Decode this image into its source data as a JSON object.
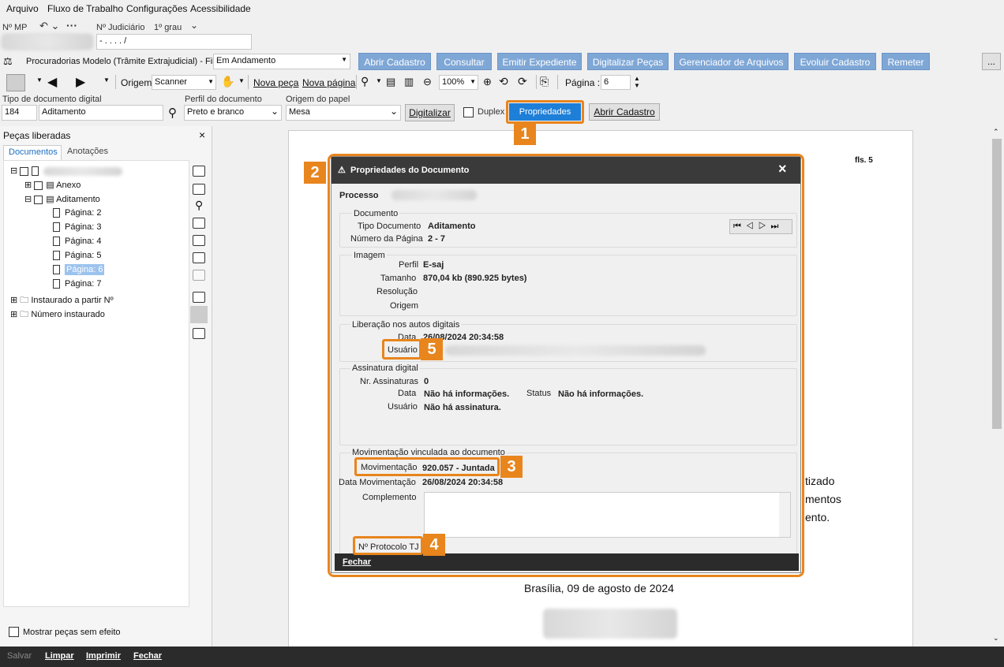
{
  "menu": [
    "Arquivo",
    "Fluxo de Trabalho",
    "Configurações",
    "Acessibilidade"
  ],
  "row2": {
    "mp_label": "Nº MP",
    "judicial_label": "Nº Judiciário",
    "grau": "1º grau",
    "judicial_value": "-  .   .  .  .     /"
  },
  "filter": {
    "label": "Procuradorias Modelo (Trâmite Extrajudicial) - Fila",
    "value": "Em Andamento"
  },
  "actions": [
    "Abrir Cadastro",
    "Consultar",
    "Emitir Expediente",
    "Digitalizar Peças",
    "Gerenciador de Arquivos",
    "Evoluir Cadastro",
    "Remeter"
  ],
  "more_label": "...",
  "toolbar": {
    "origem_label": "Origem",
    "origem_value": "Scanner",
    "nova_peca": "Nova peça",
    "nova_pagina": "Nova página",
    "zoom": "100%",
    "pagina_label": "Página :",
    "pagina_value": "6"
  },
  "docbar": {
    "tipo_label": "Tipo de documento digital",
    "tipo_code": "184",
    "tipo_value": "Aditamento",
    "perfil_label": "Perfil do documento",
    "perfil_value": "Preto e branco",
    "origem_label": "Origem do papel",
    "origem_value": "Mesa",
    "digitalizar": "Digitalizar",
    "duplex": "Duplex",
    "propriedades": "Propriedades",
    "abrir_cadastro": "Abrir Cadastro"
  },
  "panel": {
    "title": "Peças liberadas",
    "tabs": [
      "Documentos",
      "Anotações"
    ],
    "items": [
      "Anexo",
      "Aditamento",
      "Página: 2",
      "Página: 3",
      "Página: 4",
      "Página: 5",
      "Página: 6",
      "Página: 7",
      "Instaurado a partir Nº",
      "Número instaurado"
    ],
    "show_label": "Mostrar peças sem efeito"
  },
  "paper": {
    "fls": "fls. 5",
    "frag1": "tizado",
    "frag2": "mentos",
    "frag3": "ento.",
    "date": "Brasília, 09 de agosto de 2024"
  },
  "dialog": {
    "title": "Propriedades do Documento",
    "processo_label": "Processo",
    "documento_group": "Documento",
    "tipo_label": "Tipo Documento",
    "tipo_value": "Aditamento",
    "numpag_label": "Número da Página",
    "numpag_value": "2 - 7",
    "imagem_group": "Imagem",
    "perfil_label": "Perfil",
    "perfil_value": "E-saj",
    "tamanho_label": "Tamanho",
    "tamanho_value": "870,04 kb (890.925 bytes)",
    "resolucao_label": "Resolução",
    "origem_label": "Origem",
    "liberacao_group": "Liberação nos autos digitais",
    "data_label": "Data",
    "data_value": "26/08/2024 20:34:58",
    "usuario_label": "Usuário",
    "assinatura_group": "Assinatura digital",
    "nr_ass_label": "Nr. Assinaturas",
    "nr_ass_value": "0",
    "ass_data_label": "Data",
    "ass_data_value": "Não há informações.",
    "status_label": "Status",
    "status_value": "Não há informações.",
    "ass_usuario_label": "Usuário",
    "ass_usuario_value": "Não há assinatura.",
    "mov_group": "Movimentação vinculada ao documento",
    "mov_label": "Movimentação",
    "mov_value": "920.057 - Juntada",
    "datamov_label": "Data Movimentação",
    "datamov_value": "26/08/2024 20:34:58",
    "complemento_label": "Complemento",
    "protocolo_label": "Nº Protocolo TJ",
    "fechar": "Fechar"
  },
  "callouts": [
    "1",
    "2",
    "3",
    "4",
    "5"
  ],
  "bottom": [
    "Salvar",
    "Limpar",
    "Imprimir",
    "Fechar"
  ],
  "colors": {
    "accent": "#e8851d",
    "action_blue": "#7fa7d6",
    "primary_blue": "#1e7fd8"
  }
}
